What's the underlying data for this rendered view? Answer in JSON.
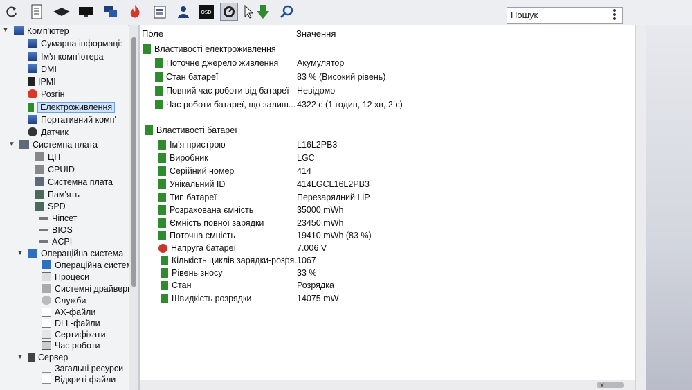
{
  "toolbar": {
    "icons": [
      "refresh-icon",
      "report-icon",
      "display-icon",
      "monitor-icon",
      "network-icon",
      "flame-icon",
      "device-icon",
      "user-icon",
      "osd-icon",
      "sensor-icon",
      "cursor-icon",
      "download-icon",
      "search-icon"
    ],
    "osd_label": "OSD",
    "search_placeholder": "Пошук"
  },
  "tree": {
    "items": [
      {
        "label": "Комп'ютер",
        "icon": "computer-icon"
      },
      {
        "label": "Сумарна інформаці:",
        "icon": "computer-icon"
      },
      {
        "label": "Ім'я комп'ютера",
        "icon": "computer-icon"
      },
      {
        "label": "DMI",
        "icon": "computer-icon"
      },
      {
        "label": "IPMI",
        "icon": "ipmi-icon"
      },
      {
        "label": "Розгін",
        "icon": "flame-icon"
      },
      {
        "label": "Електроживлення",
        "icon": "battery-icon"
      },
      {
        "label": "Портативний комп'",
        "icon": "computer-icon"
      },
      {
        "label": "Датчик",
        "icon": "sensor-icon"
      },
      {
        "label": "Системна плата",
        "icon": "motherboard-icon"
      },
      {
        "label": "ЦП",
        "icon": "cpu-icon"
      },
      {
        "label": "CPUID",
        "icon": "cpu-icon"
      },
      {
        "label": "Системна плата",
        "icon": "motherboard-icon"
      },
      {
        "label": "Пам'ять",
        "icon": "memory-icon"
      },
      {
        "label": "SPD",
        "icon": "memory-icon"
      },
      {
        "label": "Чіпсет",
        "icon": "chipset-icon"
      },
      {
        "label": "BIOS",
        "icon": "chipset-icon"
      },
      {
        "label": "ACPI",
        "icon": "chipset-icon"
      },
      {
        "label": "Операційна система",
        "icon": "windows-icon"
      },
      {
        "label": "Операційна система",
        "icon": "windows-icon"
      },
      {
        "label": "Процеси",
        "icon": "process-icon"
      },
      {
        "label": "Системні драйвери",
        "icon": "driver-icon"
      },
      {
        "label": "Служби",
        "icon": "service-icon"
      },
      {
        "label": "AX-файли",
        "icon": "file-icon"
      },
      {
        "label": "DLL-файли",
        "icon": "file-icon"
      },
      {
        "label": "Сертифікати",
        "icon": "certificate-icon"
      },
      {
        "label": "Час роботи",
        "icon": "clock-icon"
      },
      {
        "label": "Сервер",
        "icon": "server-icon"
      },
      {
        "label": "Загальні ресурси",
        "icon": "share-icon"
      },
      {
        "label": "Відкриті файли",
        "icon": "file-icon"
      }
    ]
  },
  "table": {
    "col_field": "Поле",
    "col_value": "Значення",
    "group_power": "Властивості електроживлення",
    "power_rows": [
      {
        "field": "Поточне джерело живлення",
        "value": "Акумулятор"
      },
      {
        "field": "Стан батареї",
        "value": "83 % (Високий рівень)"
      },
      {
        "field": "Повний час роботи від батареї",
        "value": "Невідомо"
      },
      {
        "field": "Час роботи батареї, що залиш...",
        "value": "4322 с (1 годин, 12 хв, 2 с)"
      }
    ],
    "group_battery": "Властивості батареї",
    "battery_rows": [
      {
        "field": "Ім'я пристрою",
        "value": "L16L2PB3"
      },
      {
        "field": "Виробник",
        "value": "LGC"
      },
      {
        "field": "Серійний номер",
        "value": "414"
      },
      {
        "field": "Унікальний ID",
        "value": "414LGCL16L2PB3"
      },
      {
        "field": "Тип батареї",
        "value": "Перезарядний LiP"
      },
      {
        "field": "Розрахована ємність",
        "value": "35000 mWh"
      },
      {
        "field": "Ємність повної зарядки",
        "value": "23450 mWh"
      },
      {
        "field": "Поточна ємність",
        "value": "19410 mWh  (83 %)"
      },
      {
        "field": "Напруга батареї",
        "value": "7.006 V"
      },
      {
        "field": "Кількість циклів зарядки-розря...",
        "value": "1067"
      },
      {
        "field": "Рівень зносу",
        "value": "33 %"
      },
      {
        "field": "Стан",
        "value": "Розрядка"
      },
      {
        "field": "Швидкість розрядки",
        "value": "14075 mW"
      }
    ]
  },
  "colors": {
    "accent": "#2f6fc0",
    "battery_green": "#2e8b2e",
    "selection": "#cde3ff"
  }
}
